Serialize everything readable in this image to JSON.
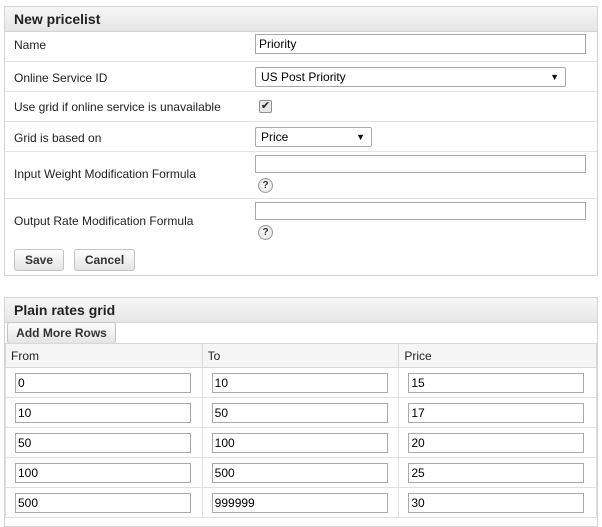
{
  "new_pricelist": {
    "title": "New pricelist",
    "name_label": "Name",
    "name_value": "Priority",
    "online_service_label": "Online Service ID",
    "online_service_value": "US Post Priority",
    "use_grid_label": "Use grid if online service is unavailable",
    "use_grid_checked": true,
    "grid_based_label": "Grid is based on",
    "grid_based_value": "Price",
    "input_weight_label": "Input Weight Modification Formula",
    "input_weight_value": "",
    "output_rate_label": "Output Rate Modification Formula",
    "output_rate_value": "",
    "help_glyph": "?",
    "save_label": "Save",
    "cancel_label": "Cancel"
  },
  "plain_rates": {
    "title": "Plain rates grid",
    "add_rows_label": "Add More Rows",
    "columns": [
      "From",
      "To",
      "Price"
    ],
    "rows": [
      [
        "0",
        "10",
        "15"
      ],
      [
        "10",
        "50",
        "17"
      ],
      [
        "50",
        "100",
        "20"
      ],
      [
        "100",
        "500",
        "25"
      ],
      [
        "500",
        "999999",
        "30"
      ]
    ]
  },
  "icons": {
    "dropdown": "chevron-down-icon",
    "help": "help-icon",
    "checkmark": "checkmark-icon"
  }
}
